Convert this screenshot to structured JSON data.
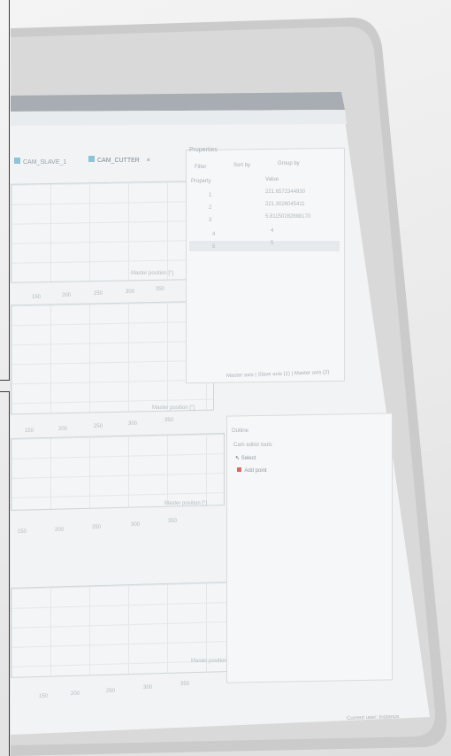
{
  "editor_tabs": {
    "tab1": "CAM_SLAVE_1",
    "tab2": "CAM_CUTTER",
    "close": "×"
  },
  "properties_panel": {
    "title": "Properties",
    "toolbar": {
      "filter": "Filter",
      "sort": "Sort by",
      "group": "Group by"
    },
    "columns": {
      "property": "Property",
      "value": "Value"
    },
    "rows": [
      {
        "key": "1",
        "value": "221.6572344930"
      },
      {
        "key": "2",
        "value": "221.3026045411"
      },
      {
        "key": "3",
        "value": "5.81150282888170"
      },
      {
        "key": "4",
        "value": "4"
      },
      {
        "key": "5",
        "value": "5"
      }
    ],
    "footer": "Master axis | Slave axis (1) | Master axis (2)"
  },
  "outline_panel": {
    "title": "Outline",
    "header": "Cam editor tools",
    "items": [
      {
        "label": "Select",
        "icon": "cursor-icon"
      },
      {
        "label": "Add point",
        "icon": "red-square-icon"
      }
    ]
  },
  "charts": [
    {
      "axis_caption": "Master position [°]",
      "ticks": [
        "150",
        "200",
        "250",
        "300",
        "350"
      ]
    },
    {
      "axis_caption": "Master position [°]",
      "ticks": [
        "150",
        "200",
        "250",
        "300",
        "350"
      ]
    },
    {
      "axis_caption": "Master position [°]",
      "ticks": [
        "150",
        "200",
        "250",
        "300",
        "350"
      ]
    },
    {
      "axis_caption": "Master position [°]",
      "ticks": [
        "150",
        "200",
        "250",
        "300",
        "350"
      ]
    }
  ],
  "status_bar": {
    "text": "Current user: Instance"
  },
  "colors": {
    "bezel": "#c8c8c8",
    "screen_bg": "#f3f5f6",
    "grid": "#e4e8eb",
    "frame_line": "#3a3a3a"
  }
}
